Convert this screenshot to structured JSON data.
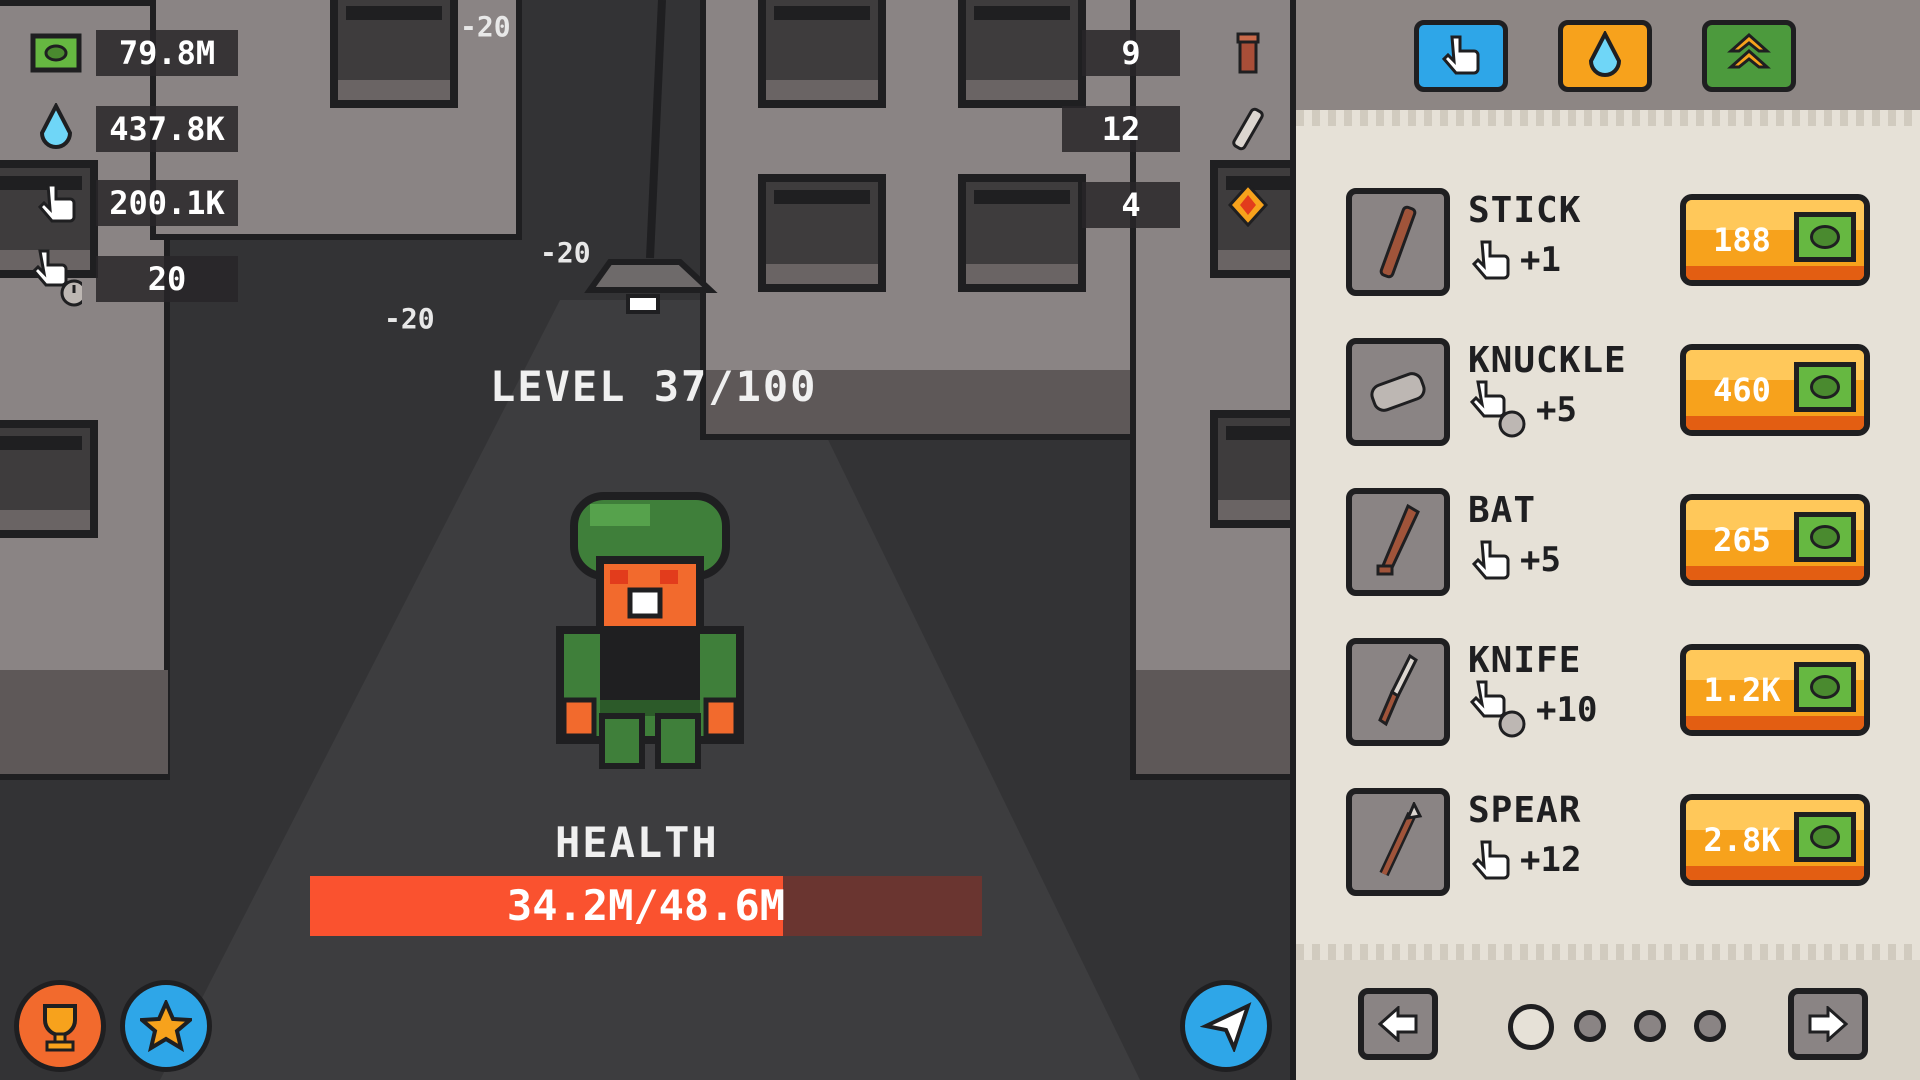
{
  "resources": [
    {
      "icon": "cash-icon",
      "value": "79.8M"
    },
    {
      "icon": "water-drop-icon",
      "value": "437.8K"
    },
    {
      "icon": "tap-hand-icon",
      "value": "200.1K"
    },
    {
      "icon": "auto-tap-icon",
      "value": "20"
    }
  ],
  "counters": [
    {
      "icon": "fire-hydrant-icon",
      "value": "9"
    },
    {
      "icon": "bandage-icon",
      "value": "12"
    },
    {
      "icon": "gem-icon",
      "value": "4"
    }
  ],
  "damage_popups": [
    "-20",
    "-20",
    "-20"
  ],
  "level": {
    "label": "LEVEL 37/100",
    "current": 37,
    "max": 100
  },
  "health": {
    "label": "HEALTH",
    "text": "34.2M/48.6M",
    "fraction": 0.704
  },
  "bottom_buttons": {
    "trophy": "trophy-icon",
    "star": "star-icon",
    "share": "paper-plane-icon"
  },
  "shop": {
    "tabs": [
      {
        "name": "tap-upgrades",
        "icon": "tap-hand-icon",
        "color": "#2ea6e8"
      },
      {
        "name": "water-upgrades",
        "icon": "water-drop-icon",
        "color": "#f7a21c"
      },
      {
        "name": "rank-upgrades",
        "icon": "rank-chevron-icon",
        "color": "#4c9a3d"
      }
    ],
    "items": [
      {
        "name": "STICK",
        "bonus_type": "tap",
        "bonus": "+1",
        "price": "188"
      },
      {
        "name": "KNUCKLE",
        "bonus_type": "auto",
        "bonus": "+5",
        "price": "460"
      },
      {
        "name": "BAT",
        "bonus_type": "tap",
        "bonus": "+5",
        "price": "265"
      },
      {
        "name": "KNIFE",
        "bonus_type": "auto",
        "bonus": "+10",
        "price": "1.2K"
      },
      {
        "name": "SPEAR",
        "bonus_type": "tap",
        "bonus": "+12",
        "price": "2.8K"
      }
    ],
    "pagination": {
      "pages": 4,
      "current": 1
    }
  }
}
